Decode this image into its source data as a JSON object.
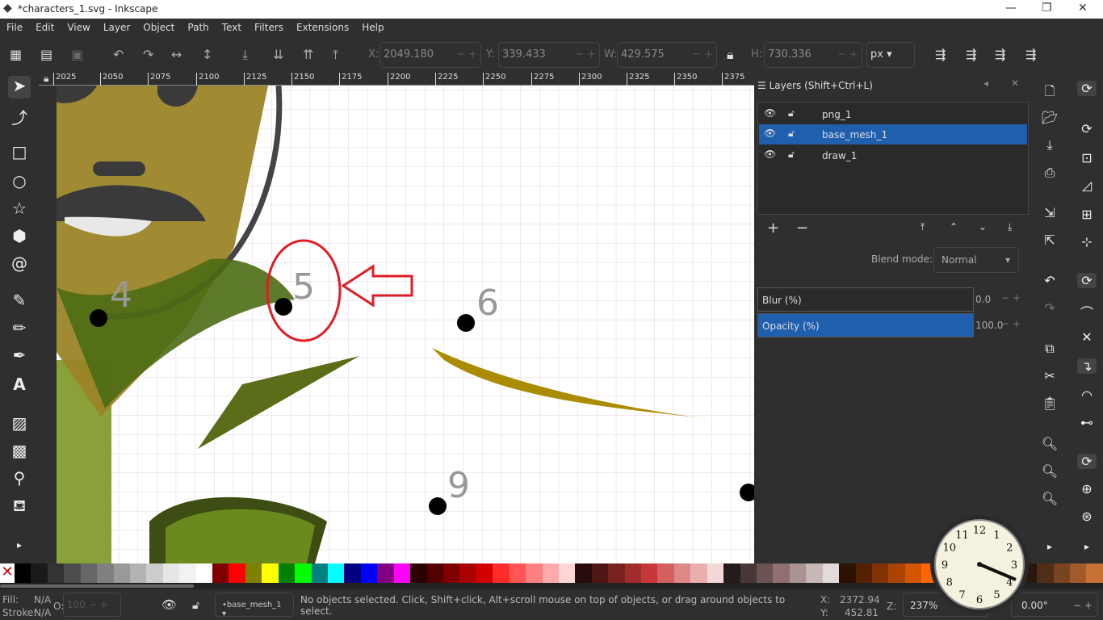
{
  "window": {
    "title": "*characters_1.svg - Inkscape"
  },
  "menu": [
    "File",
    "Edit",
    "View",
    "Layer",
    "Object",
    "Path",
    "Text",
    "Filters",
    "Extensions",
    "Help"
  ],
  "toolbar": {
    "x_label": "X:",
    "x": "2049.180",
    "y_label": "Y:",
    "y": "339.433",
    "w_label": "W:",
    "w": "429.575",
    "h_label": "H:",
    "h": "730.336",
    "unit": "px"
  },
  "ruler": [
    "2025",
    "2050",
    "2075",
    "2100",
    "2125",
    "2150",
    "2175",
    "2200",
    "2225",
    "2250",
    "2275",
    "2300",
    "2325",
    "2350",
    "2375"
  ],
  "canvas": {
    "labels": [
      "4",
      "5",
      "6",
      "9"
    ]
  },
  "layers": {
    "title": "Layers (Shift+Ctrl+L)",
    "items": [
      {
        "name": "png_1",
        "selected": false
      },
      {
        "name": "base_mesh_1",
        "selected": true
      },
      {
        "name": "draw_1",
        "selected": false
      }
    ],
    "blend_label": "Blend mode:",
    "blend": "Normal",
    "blur_label": "Blur (%)",
    "blur": "0.0",
    "opacity_label": "Opacity (%)",
    "opacity": "100.0"
  },
  "palette": [
    "#000000",
    "#1a1a1a",
    "#333333",
    "#4d4d4d",
    "#666666",
    "#808080",
    "#999999",
    "#b3b3b3",
    "#cccccc",
    "#e6e6e6",
    "#f2f2f2",
    "#ffffff",
    "#800000",
    "#ff0000",
    "#808000",
    "#ffff00",
    "#008000",
    "#00ff00",
    "#008080",
    "#00ffff",
    "#000080",
    "#0000ff",
    "#800080",
    "#ff00ff",
    "#2b0000",
    "#550000",
    "#800000",
    "#aa0000",
    "#d40000",
    "#ff2a2a",
    "#ff5555",
    "#ff8080",
    "#ffaaaa",
    "#ffd5d5",
    "#280b0b",
    "#501616",
    "#782121",
    "#a02c2c",
    "#c83737",
    "#d35f5f",
    "#de8787",
    "#e9afaf",
    "#f4d7d7",
    "#241c1c",
    "#483737",
    "#6c5353",
    "#916f6f",
    "#ac9393",
    "#c8b7b7",
    "#e3dbdb",
    "#2b1100",
    "#552200",
    "#803300",
    "#aa4400",
    "#d45500",
    "#ff6600",
    "#ff7f2a",
    "#ff9955",
    "#ffb380",
    "#ffccaa",
    "#ffe6d5",
    "#28170b",
    "#502d16",
    "#784421",
    "#a05a2c",
    "#c87137"
  ],
  "status": {
    "fill_label": "Fill:",
    "fill": "N/A",
    "stroke_label": "Stroke:",
    "stroke": "N/A",
    "opacity_label": "O:",
    "opacity": "100",
    "layer": "•base_mesh_1",
    "message": "No objects selected. Click, Shift+click, Alt+scroll mouse on top of objects, or drag around objects to select.",
    "x_label": "X:",
    "x": "2372.94",
    "y_label": "Y:",
    "y": "452.81",
    "zoom_label": "Z:",
    "zoom": "237%",
    "rotation": "0.00°"
  },
  "clock": {
    "numbers": [
      "12",
      "1",
      "2",
      "3",
      "4",
      "5",
      "6",
      "7",
      "8",
      "9",
      "10",
      "11"
    ]
  }
}
